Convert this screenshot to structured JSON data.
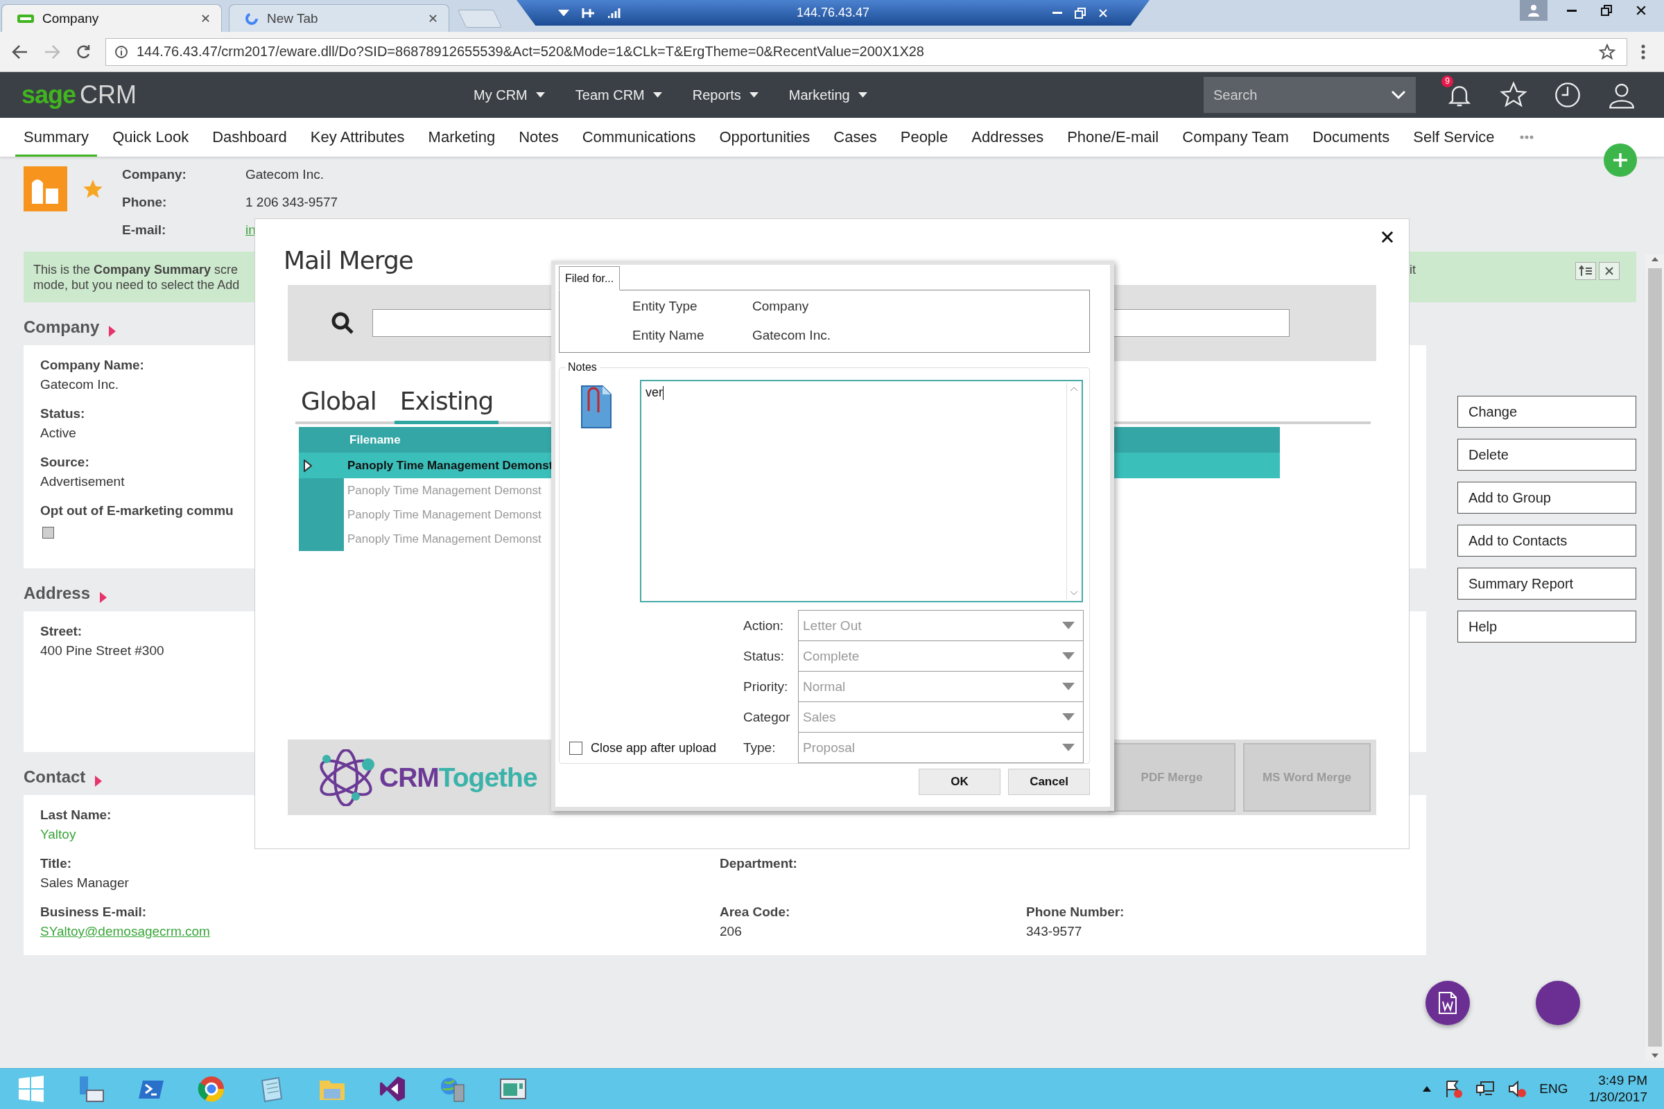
{
  "browser": {
    "tabs": [
      {
        "title": "Company",
        "selected": true
      },
      {
        "title": "New Tab",
        "selected": false
      }
    ],
    "remote_host": "144.76.43.47",
    "url": "144.76.43.47/crm2017/eware.dll/Do?SID=86878912655539&Act=520&Mode=1&CLk=T&ErgTheme=0&RecentValue=200X1X28"
  },
  "app": {
    "logo": {
      "brand": "sage",
      "product": "CRM"
    },
    "menus": [
      "My CRM",
      "Team CRM",
      "Reports",
      "Marketing"
    ],
    "search": {
      "placeholder": "Search"
    },
    "notification_count": "9"
  },
  "tabs": [
    {
      "label": "Summary",
      "selected": true
    },
    {
      "label": "Quick Look",
      "selected": false
    },
    {
      "label": "Dashboard",
      "selected": false
    },
    {
      "label": "Key Attributes",
      "selected": false
    },
    {
      "label": "Marketing",
      "selected": false
    },
    {
      "label": "Notes",
      "selected": false
    },
    {
      "label": "Communications",
      "selected": false
    },
    {
      "label": "Opportunities",
      "selected": false
    },
    {
      "label": "Cases",
      "selected": false
    },
    {
      "label": "People",
      "selected": false
    },
    {
      "label": "Addresses",
      "selected": false
    },
    {
      "label": "Phone/E-mail",
      "selected": false
    },
    {
      "label": "Company Team",
      "selected": false
    },
    {
      "label": "Documents",
      "selected": false
    },
    {
      "label": "Self Service",
      "selected": false
    }
  ],
  "header": {
    "fields": [
      {
        "label": "Company:",
        "value": "Gatecom Inc.",
        "kind": "text"
      },
      {
        "label": "Phone:",
        "value": "1 206 343-9577",
        "kind": "text"
      },
      {
        "label": "E-mail:",
        "value": "in",
        "kind": "link"
      }
    ]
  },
  "banner": {
    "lines": [
      "This is the **Company Summary** scre",
      "mode, but you need to select the Add"
    ],
    "fragment": "it"
  },
  "sections": [
    {
      "title": "Company",
      "rows": [
        [
          {
            "label": "Company Name:",
            "value": "Gatecom Inc.",
            "kind": "text"
          }
        ],
        [
          {
            "label": "Status:",
            "value": "Active",
            "kind": "text"
          }
        ],
        [
          {
            "label": "Source:",
            "value": "Advertisement",
            "kind": "text"
          }
        ],
        [
          {
            "label": "Opt out of E-marketing commu",
            "kind": "checkbox",
            "checked": false
          }
        ]
      ]
    },
    {
      "title": "Address",
      "rows": [
        [
          {
            "label": "Street:",
            "value": "400 Pine Street #300",
            "kind": "text"
          }
        ]
      ]
    },
    {
      "title": "Contact",
      "rows": [
        [
          {
            "label": "Last Name:",
            "value": "Yaltoy",
            "kind": "accent"
          }
        ],
        [
          {
            "label": "Title:",
            "value": "Sales Manager",
            "kind": "text"
          },
          {
            "label": "Department:",
            "kind": "text"
          }
        ],
        [
          {
            "label": "Business E-mail:",
            "value": "SYaltoy@demosagecrm.com",
            "kind": "link"
          },
          {
            "label": "Area Code:",
            "value": "206",
            "kind": "text"
          },
          {
            "label": "Phone Number:",
            "value": "343-9577",
            "kind": "text"
          }
        ]
      ]
    }
  ],
  "actions": [
    "Change",
    "Delete",
    "Add to Group",
    "Add to Contacts",
    "Summary Report",
    "Help"
  ],
  "mail_merge": {
    "title": "Mail Merge",
    "tabs": [
      {
        "label": "Global",
        "selected": false
      },
      {
        "label": "Existing",
        "selected": true
      }
    ],
    "table": {
      "columns": [
        "Filename"
      ],
      "rows": [
        {
          "filename": "Panoply Time Management Demonst",
          "selected": true
        },
        {
          "filename": "Panoply Time Management Demonst",
          "selected": false
        },
        {
          "filename": "Panoply Time Management Demonst",
          "selected": false
        },
        {
          "filename": "Panoply Time Management Demonst",
          "selected": false
        }
      ]
    },
    "logo_text": [
      "CRM",
      "Togethe"
    ],
    "buttons": [
      {
        "label": "PDF Merge",
        "disabled": true
      },
      {
        "label": "MS Word Merge",
        "disabled": true
      }
    ]
  },
  "dialog": {
    "tab": "Filed for...",
    "entity": [
      {
        "label": "Entity Type",
        "value": "Company"
      },
      {
        "label": "Entity Name",
        "value": "Gatecom Inc."
      }
    ],
    "notes": {
      "label": "Notes",
      "value": "ver"
    },
    "fields": [
      {
        "label": "Action:",
        "value": "Letter Out"
      },
      {
        "label": "Status:",
        "value": "Complete"
      },
      {
        "label": "Priority:",
        "value": "Normal"
      },
      {
        "label": "Categor",
        "value": "Sales"
      },
      {
        "label": "Type:",
        "value": "Proposal"
      }
    ],
    "close_app": {
      "label": "Close app after upload",
      "checked": false
    },
    "buttons": [
      "OK",
      "Cancel"
    ]
  },
  "taskbar": {
    "language": "ENG",
    "time": "3:49 PM",
    "date": "1/30/2017"
  }
}
